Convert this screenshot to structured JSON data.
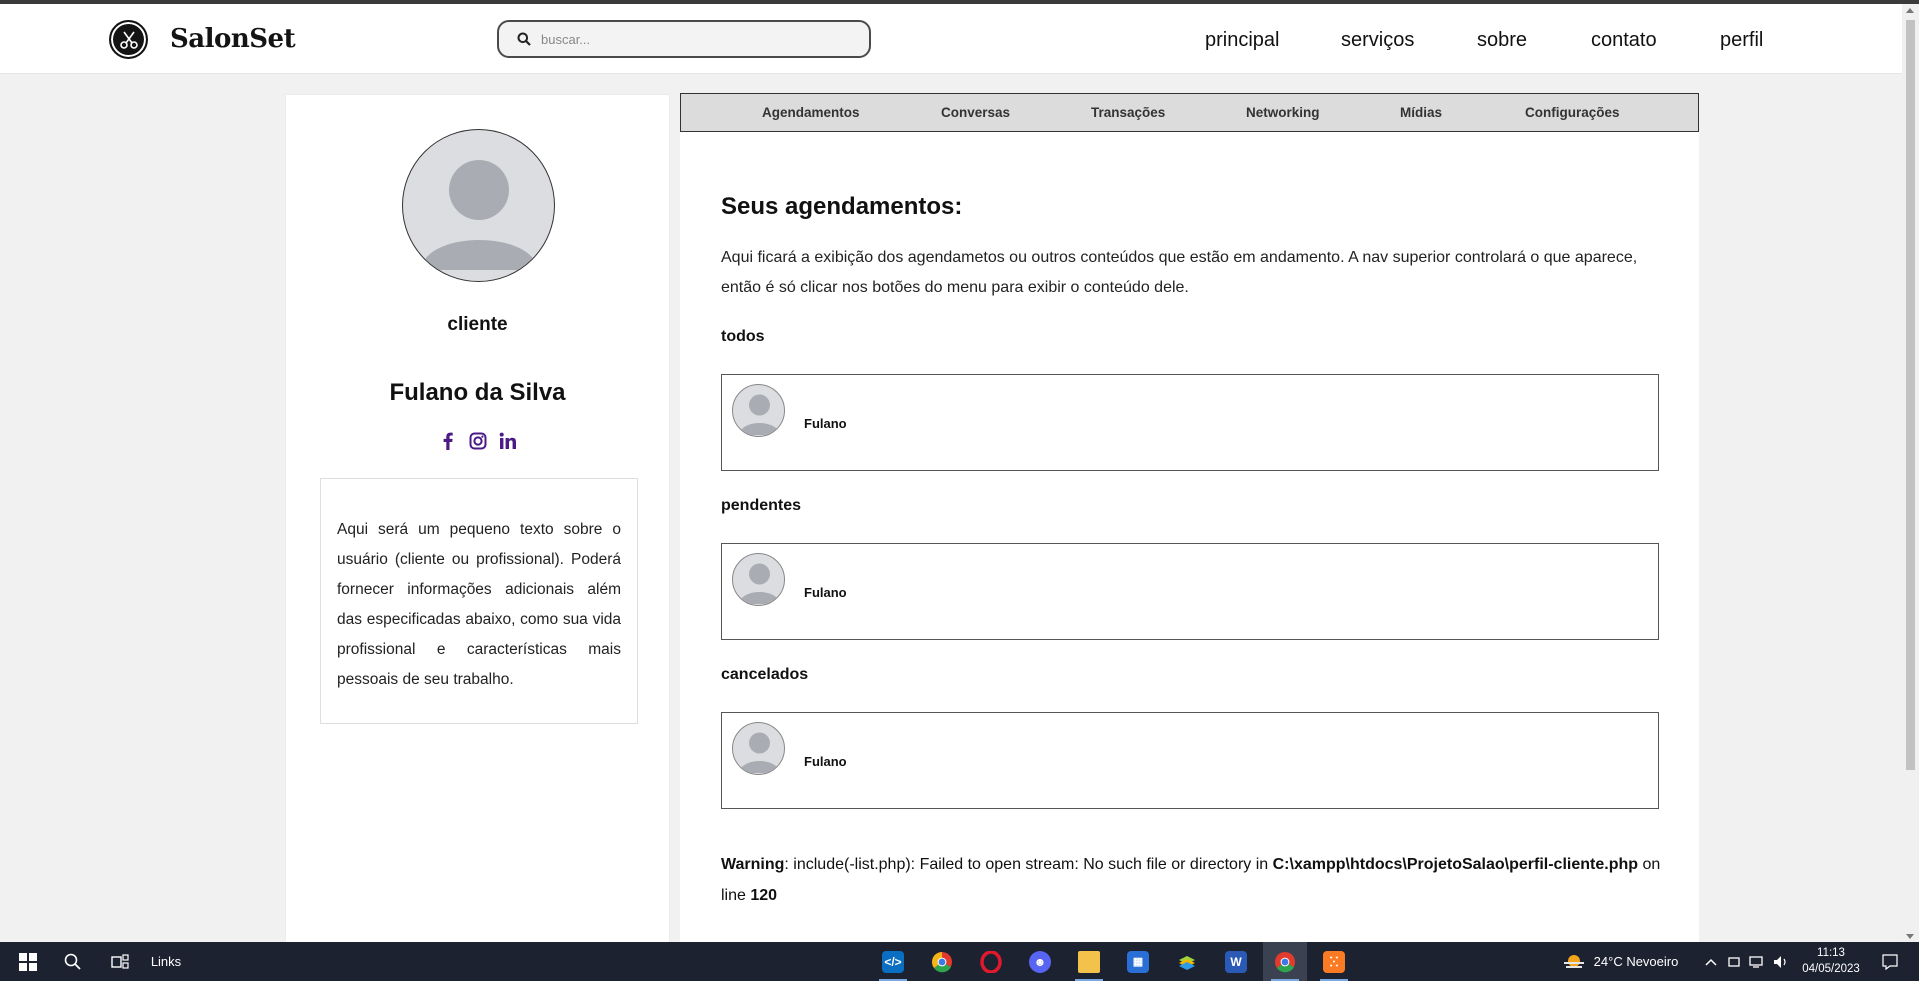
{
  "header": {
    "brand": "SalonSet",
    "search_placeholder": "buscar...",
    "nav": [
      "principal",
      "serviços",
      "sobre",
      "contato",
      "perfil"
    ]
  },
  "profile": {
    "role": "cliente",
    "name": "Fulano da Silva",
    "socials": [
      "facebook-icon",
      "instagram-icon",
      "linkedin-icon"
    ],
    "about": "Aqui será um pequeno texto sobre o usuário (cliente ou profissional). Poderá fornecer informações adicionais além das especificadas abaixo, como sua vida profissional e características mais pessoais de seu trabalho."
  },
  "tabs": [
    "Agendamentos",
    "Conversas",
    "Transações",
    "Networking",
    "Mídias",
    "Configurações"
  ],
  "main": {
    "title": "Seus agendamentos:",
    "description": "Aqui ficará a exibição dos agendametos ou outros conteúdos que estão em andamento. A nav superior controlará o que aparece, então é só clicar nos botões do menu para exibir o conteúdo dele.",
    "sections": [
      {
        "label": "todos",
        "item_name": "Fulano"
      },
      {
        "label": "pendentes",
        "item_name": "Fulano"
      },
      {
        "label": "cancelados",
        "item_name": "Fulano"
      }
    ],
    "warning": {
      "label": "Warning",
      "message": ": include(-list.php): Failed to open stream: No such file or directory in ",
      "path": "C:\\xampp\\htdocs\\ProjetoSalao\\perfil-cliente.php",
      "on_line": " on line ",
      "line": "120"
    }
  },
  "taskbar": {
    "links_label": "Links",
    "weather": "24°C  Nevoeiro",
    "time": "11:13",
    "date": "04/05/2023"
  },
  "colors": {
    "accent_social": "#4b1a86",
    "taskbar_bg": "#1c2230",
    "tab_bar_bg": "#dcdcdc"
  }
}
